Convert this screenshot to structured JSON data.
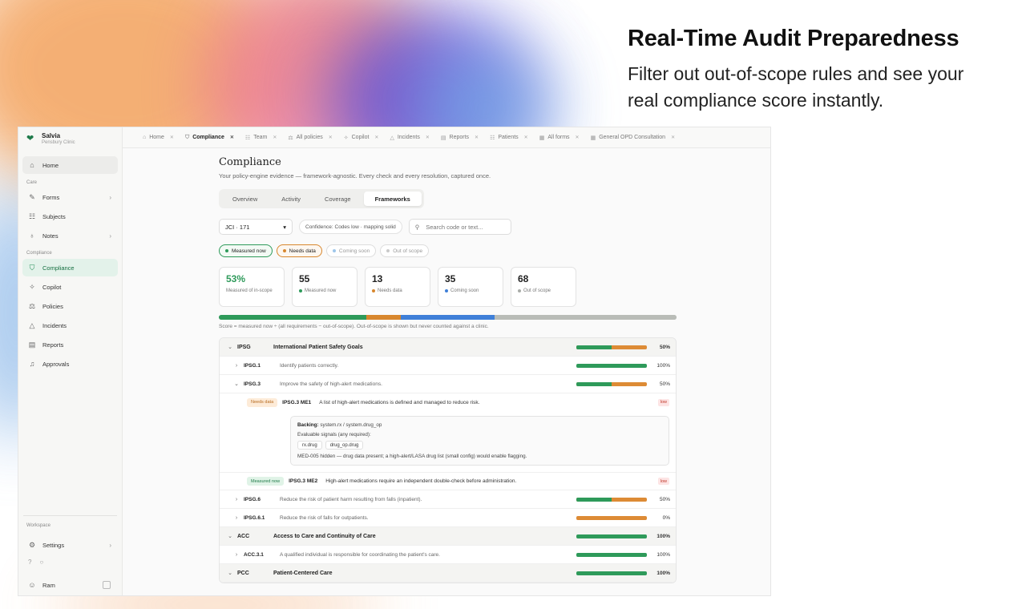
{
  "hero": {
    "title": "Real-Time Audit Preparedness",
    "subtitle": "Filter out out-of-scope rules and see your real compliance score instantly."
  },
  "brand": {
    "name": "Salvia",
    "clinic": "Pensbury Clinic"
  },
  "sidebar": {
    "home": "Home",
    "care_label": "Care",
    "care_items": [
      {
        "label": "Forms",
        "icon": "form-icon",
        "chevron": true
      },
      {
        "label": "Subjects",
        "icon": "people-icon",
        "chevron": false
      },
      {
        "label": "Notes",
        "icon": "mic-icon",
        "chevron": true
      }
    ],
    "compliance_label": "Compliance",
    "compliance_items": [
      {
        "label": "Compliance",
        "icon": "shield-icon",
        "active": true
      },
      {
        "label": "Copilot",
        "icon": "sparkle-icon"
      },
      {
        "label": "Policies",
        "icon": "scale-icon"
      },
      {
        "label": "Incidents",
        "icon": "warning-icon"
      },
      {
        "label": "Reports",
        "icon": "report-icon"
      },
      {
        "label": "Approvals",
        "icon": "bell-icon"
      }
    ],
    "workspace_label": "Workspace",
    "settings": "Settings",
    "user": "Ram"
  },
  "tabs": [
    {
      "label": "Home",
      "icon": "⌂"
    },
    {
      "label": "Compliance",
      "icon": "⛉",
      "active": true
    },
    {
      "label": "Team",
      "icon": "☷"
    },
    {
      "label": "All policies",
      "icon": "⚖"
    },
    {
      "label": "Copilot",
      "icon": "✧"
    },
    {
      "label": "Incidents",
      "icon": "△"
    },
    {
      "label": "Reports",
      "icon": "▤"
    },
    {
      "label": "Patients",
      "icon": "☷"
    },
    {
      "label": "All forms",
      "icon": "▦"
    },
    {
      "label": "General OPD Consultation",
      "icon": "▦"
    }
  ],
  "page": {
    "title": "Compliance",
    "subtitle": "Your policy-engine evidence — framework-agnostic. Every check and every resolution, captured once.",
    "segments": [
      "Overview",
      "Activity",
      "Coverage",
      "Frameworks"
    ],
    "active_segment": "Frameworks"
  },
  "filters": {
    "framework": "JCI · 171",
    "confidence": "Confidence: Codes low · mapping solid",
    "search_placeholder": "Search code or text..."
  },
  "status_chips": [
    {
      "label": "Measured now",
      "color": "#2e9a5a",
      "on": "on1"
    },
    {
      "label": "Needs data",
      "color": "#d8872e",
      "on": "on2"
    },
    {
      "label": "Coming soon",
      "color": "#9ec6ea",
      "on": ""
    },
    {
      "label": "Out of scope",
      "color": "#c9c9c9",
      "on": ""
    }
  ],
  "stats": [
    {
      "value": "53%",
      "label": "Measured of in-scope",
      "color": "",
      "green": true
    },
    {
      "value": "55",
      "label": "Measured now",
      "color": "#2e9a5a"
    },
    {
      "value": "13",
      "label": "Needs data",
      "color": "#d8872e"
    },
    {
      "value": "35",
      "label": "Coming soon",
      "color": "#3f7fd8"
    },
    {
      "value": "68",
      "label": "Out of scope",
      "color": "#a9aca8"
    }
  ],
  "score_bar": [
    {
      "status": "Measured now",
      "count": 55,
      "color": "#2e9a5a"
    },
    {
      "status": "Needs data",
      "count": 13,
      "color": "#d8872e"
    },
    {
      "status": "Coming soon",
      "count": 35,
      "color": "#3f7fd8"
    },
    {
      "status": "Out of scope",
      "count": 68,
      "color": "#b9bcb7"
    }
  ],
  "score_note": "Score = measured now ÷ (all requirements − out-of-scope). Out-of-scope is shown but never counted against a clinic.",
  "tree": {
    "ipsg": {
      "code": "IPSG",
      "title": "International Patient Safety Goals",
      "pct": "50%",
      "fill": 0.5
    },
    "ipsg1": {
      "code": "IPSG.1",
      "desc": "Identify patients correctly.",
      "pct": "100%",
      "fill": 1
    },
    "ipsg3": {
      "code": "IPSG.3",
      "desc": "Improve the safety of high-alert medications.",
      "pct": "50%",
      "fill": 0.5
    },
    "me1": {
      "status": "Needs data",
      "code": "IPSG.3 ME1",
      "desc": "A list of high-alert medications is defined and managed to reduce risk.",
      "severity": "low"
    },
    "backing": {
      "backing_label": "Backing:",
      "backing_value": "system.rx / system.drug_op",
      "signals_label": "Evaluable signals (any required):",
      "signals": [
        "rx.drug",
        "drug_op.drug"
      ],
      "note": "MED-005 hidden — drug data present; a high-alert/LASA drug list (small config) would enable flagging."
    },
    "me2": {
      "status": "Measured now",
      "code": "IPSG.3 ME2",
      "desc": "High-alert medications require an independent double-check before administration.",
      "severity": "low"
    },
    "ipsg6": {
      "code": "IPSG.6",
      "desc": "Reduce the risk of patient harm resulting from falls (inpatient).",
      "pct": "50%",
      "fill": 0.5
    },
    "ipsg61": {
      "code": "IPSG.6.1",
      "desc": "Reduce the risk of falls for outpatients.",
      "pct": "0%",
      "fill": 0
    },
    "acc": {
      "code": "ACC",
      "title": "Access to Care and Continuity of Care",
      "pct": "100%",
      "fill": 1
    },
    "acc31": {
      "code": "ACC.3.1",
      "desc": "A qualified individual is responsible for coordinating the patient's care.",
      "pct": "100%",
      "fill": 1
    },
    "pcc": {
      "code": "PCC",
      "title": "Patient-Centered Care",
      "pct": "100%",
      "fill": 1
    }
  }
}
